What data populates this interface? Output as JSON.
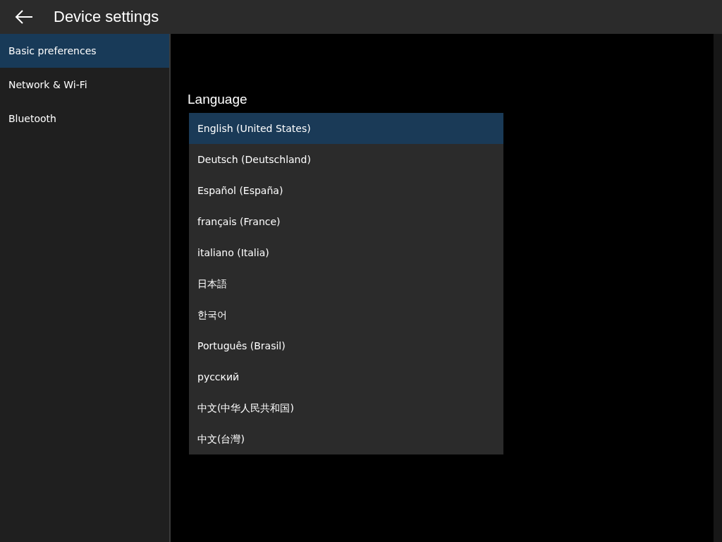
{
  "header": {
    "title": "Device settings"
  },
  "sidebar": {
    "items": [
      {
        "label": "Basic preferences",
        "selected": true
      },
      {
        "label": "Network & Wi-Fi",
        "selected": false
      },
      {
        "label": "Bluetooth",
        "selected": false
      }
    ]
  },
  "language": {
    "label": "Language",
    "options": [
      {
        "label": "English (United States)",
        "selected": true
      },
      {
        "label": "Deutsch (Deutschland)",
        "selected": false
      },
      {
        "label": "Español (España)",
        "selected": false
      },
      {
        "label": "français (France)",
        "selected": false
      },
      {
        "label": "italiano (Italia)",
        "selected": false
      },
      {
        "label": "日本語",
        "selected": false
      },
      {
        "label": "한국어",
        "selected": false
      },
      {
        "label": "Português (Brasil)",
        "selected": false
      },
      {
        "label": "русский",
        "selected": false
      },
      {
        "label": "中文(中华人民共和国)",
        "selected": false
      },
      {
        "label": "中文(台灣)",
        "selected": false
      }
    ]
  }
}
